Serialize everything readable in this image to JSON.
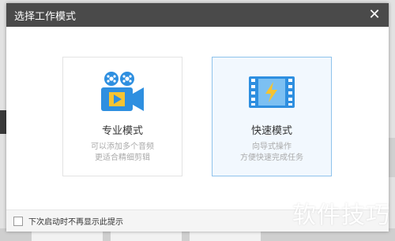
{
  "dialog": {
    "title": "选择工作模式",
    "close_icon": "close-icon"
  },
  "modes": [
    {
      "title": "专业模式",
      "line1": "可以添加多个音频",
      "line2": "更适合精细剪辑",
      "icon": "video-camera-icon"
    },
    {
      "title": "快速模式",
      "line1": "向导式操作",
      "line2": "方便快速完成任务",
      "icon": "film-strip-lightning-icon",
      "selected": true
    }
  ],
  "footer": {
    "checkbox_label": "下次启动时不再显示此提示",
    "checked": false
  },
  "watermark": "软件技巧",
  "colors": {
    "titlebar": "#4a4a4a",
    "accent": "#2e8fe0",
    "selected_border": "#8fc3ec",
    "selected_bg": "#f2f8fe"
  }
}
